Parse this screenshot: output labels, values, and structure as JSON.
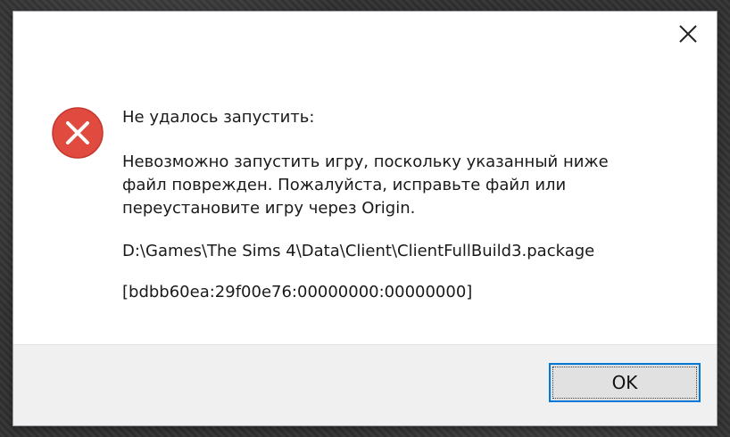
{
  "dialog": {
    "heading": "Не удалось запустить:",
    "message": "Невозможно запустить игру, поскольку указанный ниже\nфайл поврежден. Пожалуйста, исправьте файл или\nпереустановите игру через Origin.",
    "file_path": "D:\\Games\\The Sims 4\\Data\\Client\\ClientFullBuild3.package",
    "error_code": "[bdbb60ea:29f00e76:00000000:00000000]",
    "ok_label": "OK",
    "close_icon": "close-icon",
    "status_icon": "error-icon"
  },
  "colors": {
    "error_red": "#e81123",
    "accent_blue": "#0078d7",
    "footer_bg": "#f0f0f0"
  }
}
